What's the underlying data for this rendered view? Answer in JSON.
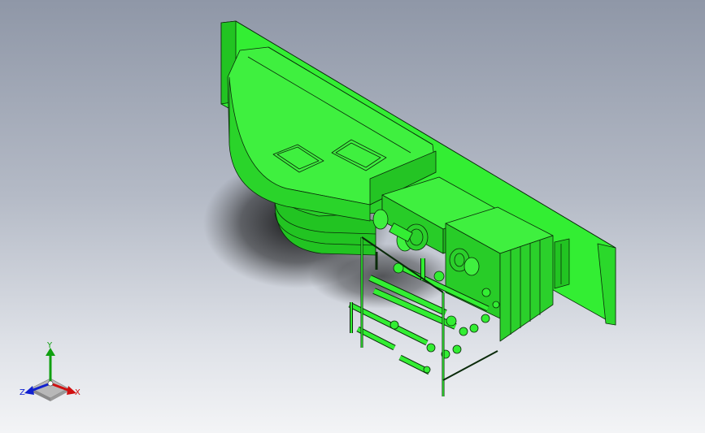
{
  "viewport": {
    "background_top": "#8f97a7",
    "background_bottom": "#f3f4f6",
    "model_color": "#33ee33",
    "edge_color": "#0a2a0a"
  },
  "triad": {
    "x_label": "X",
    "y_label": "Y",
    "z_label": "Z",
    "x_color": "#d01010",
    "y_color": "#10a010",
    "z_color": "#1020d0"
  }
}
